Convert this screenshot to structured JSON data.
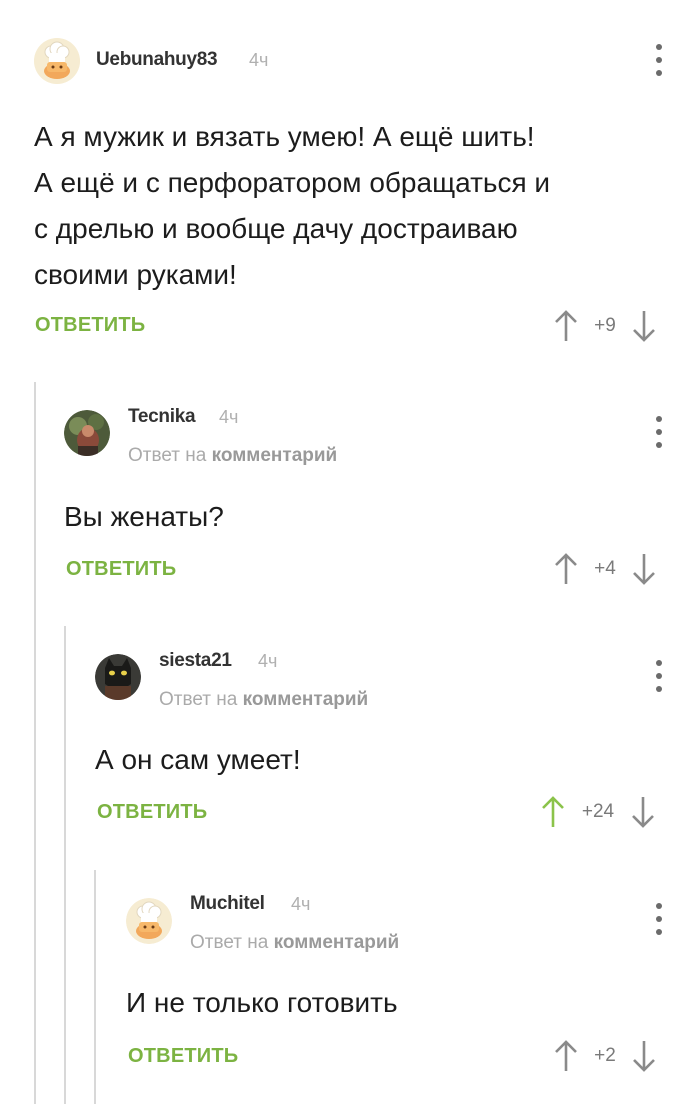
{
  "comments": [
    {
      "username": "Uebunahuy83",
      "time": "4ч",
      "reply_to": null,
      "text_lines": [
        "А я мужик и вязать умею! А ещё шить!",
        "А ещё и с перфоратором обращаться и",
        "с дрелью и вообще дачу достраиваю",
        "своими руками!"
      ],
      "reply_label": "ОТВЕТИТЬ",
      "rating": "+9",
      "upvoted": false
    },
    {
      "username": "Tecnika",
      "time": "4ч",
      "reply_to": {
        "prefix": "Ответ на",
        "target": "комментарий"
      },
      "text_lines": [
        "Вы женаты?"
      ],
      "reply_label": "ОТВЕТИТЬ",
      "rating": "+4",
      "upvoted": false
    },
    {
      "username": "siesta21",
      "time": "4ч",
      "reply_to": {
        "prefix": "Ответ на",
        "target": "комментарий"
      },
      "text_lines": [
        "А он сам умеет!"
      ],
      "reply_label": "ОТВЕТИТЬ",
      "rating": "+24",
      "upvoted": true
    },
    {
      "username": "Muchitel",
      "time": "4ч",
      "reply_to": {
        "prefix": "Ответ на",
        "target": "комментарий"
      },
      "text_lines": [
        "И не только готовить"
      ],
      "reply_label": "ОТВЕТИТЬ",
      "rating": "+2",
      "upvoted": false
    }
  ],
  "colors": {
    "accent_green": "#7cb342",
    "upvote_active": "#8bc34a",
    "arrow_gray": "#8a8a8a",
    "thread_line": "#d8d8d8"
  },
  "icons": {
    "menu": "vertical-dots-icon",
    "upvote": "arrow-up-icon",
    "downvote": "arrow-down-icon",
    "default_avatar": "chef-hat-avatar-icon"
  }
}
